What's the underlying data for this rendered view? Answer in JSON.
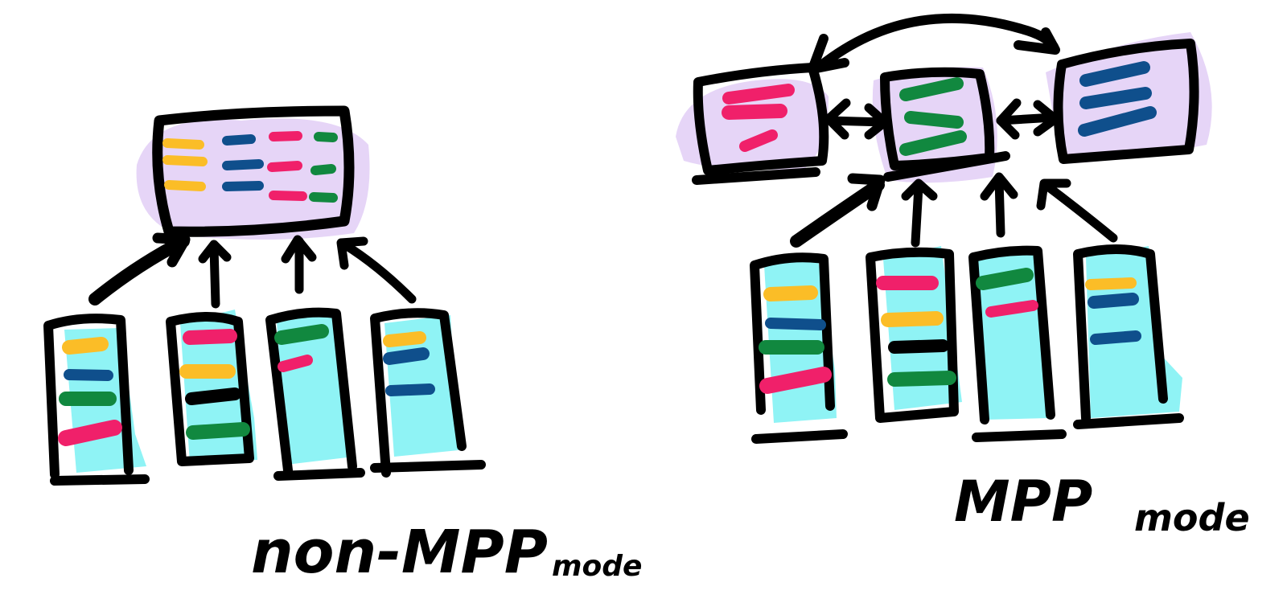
{
  "colors": {
    "outline": "#000000",
    "lavender": "#e6d5f7",
    "cyan": "#8ff3f5",
    "cyan_dark": "#1e8c8c",
    "yellow": "#fbbd27",
    "blue": "#0f4f8c",
    "green": "#11883f",
    "pink": "#f0206a",
    "black": "#000000"
  },
  "left_diagram": {
    "caption": "non-MPP",
    "caption_small": "mode"
  },
  "right_diagram": {
    "caption": "MPP",
    "caption_small": "mode"
  }
}
